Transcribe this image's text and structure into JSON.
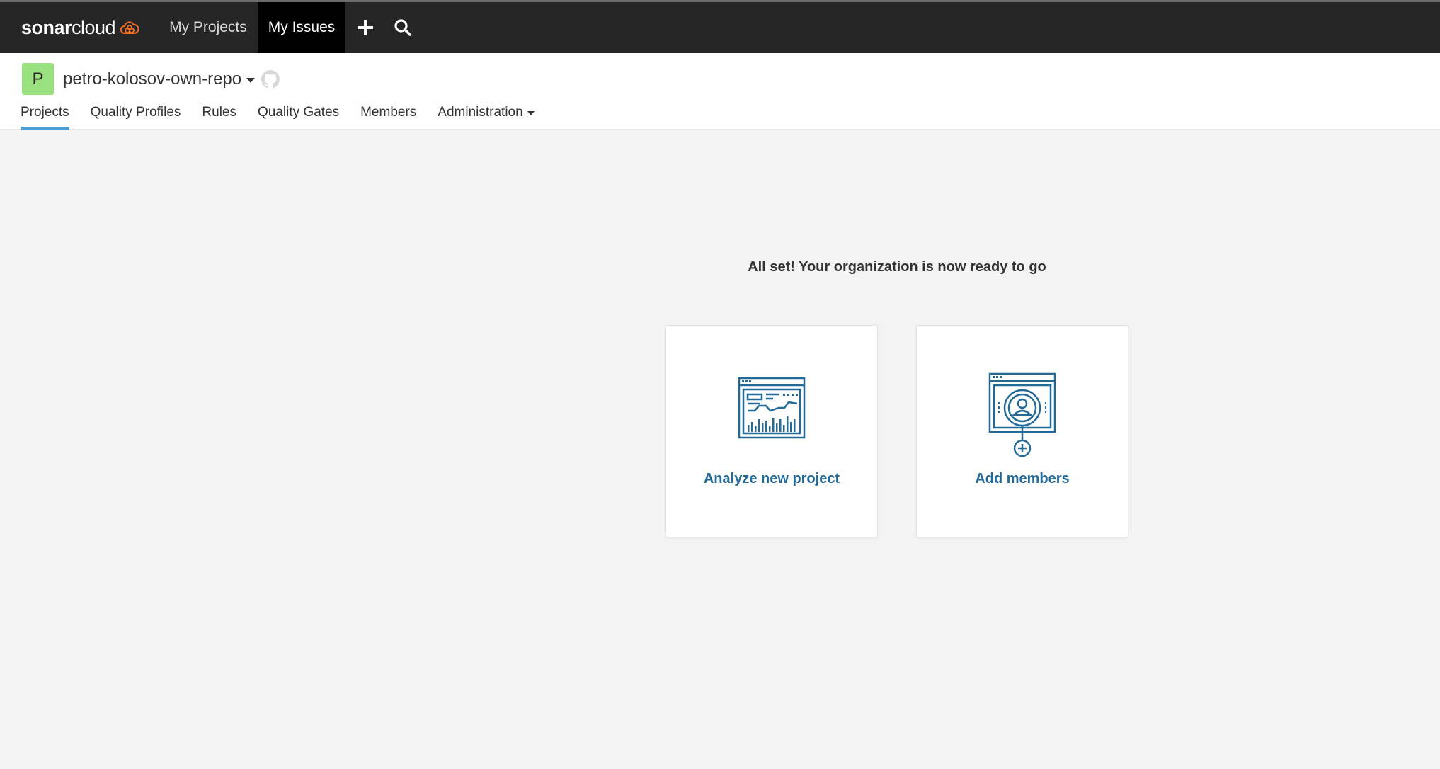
{
  "topbar": {
    "logo_brand": "sonar",
    "logo_product": "cloud",
    "nav": [
      {
        "label": "My Projects"
      },
      {
        "label": "My Issues"
      }
    ],
    "icons": [
      "plus-icon",
      "search-icon"
    ]
  },
  "org": {
    "avatar_letter": "P",
    "name": "petro-kolosov-own-repo",
    "alm_icon": "github-icon",
    "tabs": [
      {
        "label": "Projects"
      },
      {
        "label": "Quality Profiles"
      },
      {
        "label": "Rules"
      },
      {
        "label": "Quality Gates"
      },
      {
        "label": "Members"
      },
      {
        "label": "Administration"
      }
    ],
    "active_tab": "Projects"
  },
  "main": {
    "headline": "All set! Your organization is now ready to go",
    "cards": [
      {
        "label": "Analyze new project",
        "icon": "analyze-project-illustration"
      },
      {
        "label": "Add members",
        "icon": "add-members-illustration"
      }
    ]
  },
  "colors": {
    "topbar_bg": "#262626",
    "active_nav_bg": "#000000",
    "logo_accent": "#f26b21",
    "avatar_bg": "#99e07e",
    "tab_underline": "#4b9fd5",
    "card_link": "#236a97",
    "illustration": "#236a97",
    "page_bg": "#f3f3f3"
  }
}
